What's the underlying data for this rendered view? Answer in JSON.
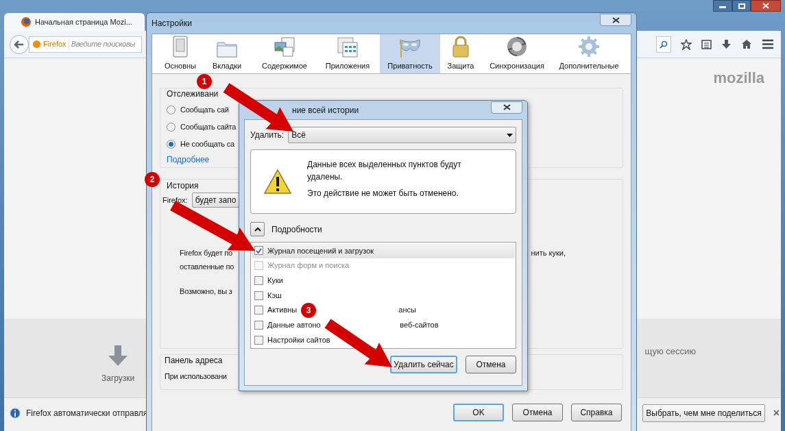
{
  "browser": {
    "tab_title": "Начальная страница Mozi...",
    "url_label": "Firefox",
    "url_placeholder": "Введите поисковы",
    "logo": "mozilla",
    "launcher": "Загрузки",
    "session_text": "щую сессию",
    "notification": {
      "text": "Firefox автоматически отправля",
      "button": "Выбрать, чем мне поделиться",
      "close": "×"
    }
  },
  "settings": {
    "title": "Настройки",
    "tabs": [
      {
        "label": "Основны",
        "selected": false
      },
      {
        "label": "Вкладки",
        "selected": false
      },
      {
        "label": "Содержимое",
        "selected": false
      },
      {
        "label": "Приложения",
        "selected": false
      },
      {
        "label": "Приватность",
        "selected": true
      },
      {
        "label": "Защита",
        "selected": false
      },
      {
        "label": "Синхронизация",
        "selected": false
      },
      {
        "label": "Дополнительные",
        "selected": false
      }
    ],
    "tracking": {
      "legend": "Отслеживани",
      "options": [
        {
          "label": "Сообщать сай",
          "selected": false
        },
        {
          "label": "Сообщать сайта",
          "selected": false
        },
        {
          "label": "Не сообщать са",
          "selected": true
        }
      ],
      "link": "Подробнее"
    },
    "history": {
      "legend": "История",
      "field_label": "Firefox:",
      "select_value": "будет запо",
      "text_1": "Firefox будет по",
      "text_1_end": "нить куки,",
      "text_2": "оставленные по",
      "text_3": "Возможно, вы з"
    },
    "address_bar": {
      "legend": "Панель адреса",
      "text": "При использовани"
    },
    "buttons": [
      {
        "label": "OK",
        "default": true
      },
      {
        "label": "Отмена",
        "default": false
      },
      {
        "label": "Справка",
        "default": false
      }
    ]
  },
  "dialog": {
    "title": "ние всей истории",
    "remove_label": "Удалить:",
    "remove_value": "Всё",
    "warning_1": "Данные всех выделенных пунктов будут удалены.",
    "warning_2": "Это действие не может быть отменено.",
    "details": "Подробности",
    "details_expanded": true,
    "items": [
      {
        "label": "Журнал посещений и загрузок",
        "checked": true,
        "disabled": false,
        "selected": true
      },
      {
        "label": "Журнал форм и поиска",
        "checked": false,
        "disabled": true,
        "selected": false
      },
      {
        "label": "Куки",
        "checked": false,
        "disabled": false,
        "selected": false
      },
      {
        "label": "Кэш",
        "checked": false,
        "disabled": false,
        "selected": false
      },
      {
        "label": "Активны",
        "tail": "ансы",
        "checked": false,
        "disabled": false,
        "selected": false
      },
      {
        "label": "Данные автоно",
        "tail": "веб-сайтов",
        "checked": false,
        "disabled": false,
        "selected": false
      },
      {
        "label": "Настройки сайтов",
        "checked": false,
        "disabled": false,
        "selected": false
      }
    ],
    "buttons": [
      {
        "label": "Удалить сейчас",
        "default": true
      },
      {
        "label": "Отмена",
        "default": false
      }
    ]
  },
  "annotations": [
    {
      "number": "1"
    },
    {
      "number": "2"
    },
    {
      "number": "3"
    }
  ]
}
